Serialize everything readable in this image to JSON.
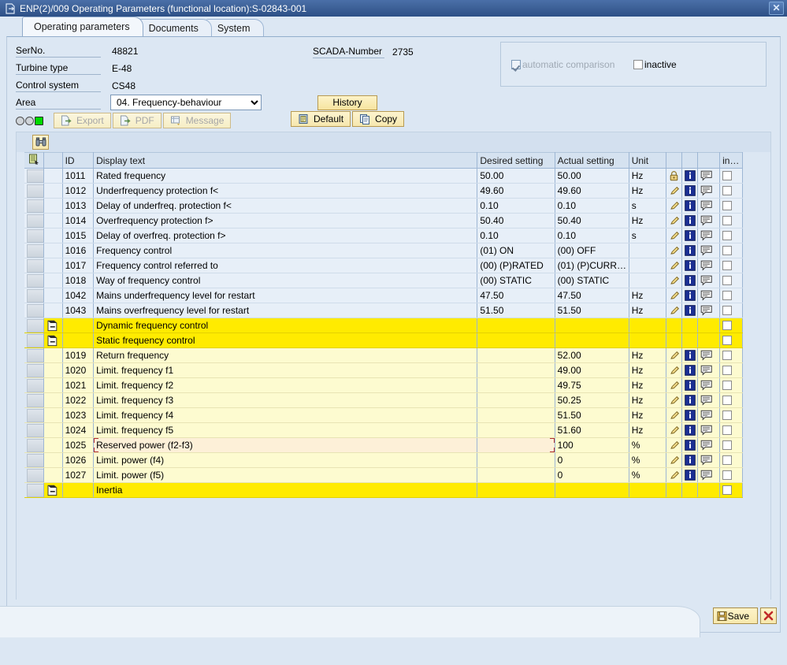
{
  "window": {
    "title": "ENP(2)/009 Operating Parameters (functional location):S-02843-001",
    "close_label": "✕",
    "icon": "window-document-icon"
  },
  "tabs": [
    {
      "label": "Operating parameters",
      "active": true
    },
    {
      "label": "Documents",
      "active": false
    },
    {
      "label": "System",
      "active": false
    }
  ],
  "form": {
    "serno_label": "SerNo.",
    "serno_value": "48821",
    "turbine_label": "Turbine type",
    "turbine_value": "E-48",
    "control_label": "Control system",
    "control_value": "CS48",
    "area_label": "Area",
    "area_value": "04. Frequency-behaviour",
    "area_options": [
      "04. Frequency-behaviour"
    ],
    "scada_label": "SCADA-Number",
    "scada_value": "2735"
  },
  "groupbox": {
    "automatic_comparison_label": "automatic comparison",
    "automatic_comparison_checked": true,
    "inactive_label": "inactive",
    "inactive_checked": false
  },
  "toolbar": {
    "export_label": "Export",
    "pdf_label": "PDF",
    "message_label": "Message",
    "history_label": "History",
    "default_label": "Default",
    "copy_label": "Copy",
    "find_icon": "binoculars-icon",
    "status_lights": [
      "gray-circle",
      "gray-circle",
      "green-square"
    ]
  },
  "grid": {
    "columns": [
      "",
      "",
      "ID",
      "Display text",
      "Desired setting",
      "Actual setting",
      "Unit",
      "",
      "",
      "",
      "in…"
    ],
    "rows": [
      {
        "kind": "normal",
        "id": "1011",
        "text": "Rated frequency",
        "desired": "50.00",
        "actual": "50.00",
        "unit": "Hz",
        "lock": true,
        "info": true,
        "note": true,
        "chk": true
      },
      {
        "kind": "normal",
        "id": "1012",
        "text": "Underfrequency protection f<",
        "desired": "49.60",
        "actual": "49.60",
        "unit": "Hz",
        "lock": false,
        "info": true,
        "note": true,
        "chk": true
      },
      {
        "kind": "normal",
        "id": "1013",
        "text": "Delay of underfreq. protection f<",
        "desired": "0.10",
        "actual": "0.10",
        "unit": "s",
        "lock": false,
        "info": true,
        "note": true,
        "chk": true
      },
      {
        "kind": "normal",
        "id": "1014",
        "text": "Overfrequency protection f>",
        "desired": "50.40",
        "actual": "50.40",
        "unit": "Hz",
        "lock": false,
        "info": true,
        "note": true,
        "chk": true
      },
      {
        "kind": "normal",
        "id": "1015",
        "text": "Delay of overfreq. protection f>",
        "desired": "0.10",
        "actual": "0.10",
        "unit": "s",
        "lock": false,
        "info": true,
        "note": true,
        "chk": true
      },
      {
        "kind": "normal",
        "id": "1016",
        "text": "Frequency control",
        "desired": "(01) ON",
        "actual": "(00) OFF",
        "unit": "",
        "lock": false,
        "info": true,
        "note": true,
        "chk": true
      },
      {
        "kind": "normal",
        "id": "1017",
        "text": "Frequency control referred to",
        "desired": "(00) (P)RATED",
        "actual": "(01) (P)CURR…",
        "unit": "",
        "lock": false,
        "info": true,
        "note": true,
        "chk": true
      },
      {
        "kind": "normal",
        "id": "1018",
        "text": "Way of frequency control",
        "desired": "(00) STATIC",
        "actual": "(00) STATIC",
        "unit": "",
        "lock": false,
        "info": true,
        "note": true,
        "chk": true
      },
      {
        "kind": "normal",
        "id": "1042",
        "text": "Mains underfrequency level for restart",
        "desired": "47.50",
        "actual": "47.50",
        "unit": "Hz",
        "lock": false,
        "info": true,
        "note": true,
        "chk": true
      },
      {
        "kind": "normal",
        "id": "1043",
        "text": "Mains overfrequency level for restart",
        "desired": "51.50",
        "actual": "51.50",
        "unit": "Hz",
        "lock": false,
        "info": true,
        "note": true,
        "chk": true
      },
      {
        "kind": "group",
        "id": "",
        "text": "Dynamic frequency control",
        "desired": "",
        "actual": "",
        "unit": "",
        "expand": true,
        "lock": false,
        "info": false,
        "note": false,
        "chk": true
      },
      {
        "kind": "group",
        "id": "",
        "text": "Static frequency control",
        "desired": "",
        "actual": "",
        "unit": "",
        "expand": true,
        "lock": false,
        "info": false,
        "note": false,
        "chk": true
      },
      {
        "kind": "child",
        "id": "1019",
        "text": "Return frequency",
        "desired": "",
        "actual": "52.00",
        "unit": "Hz",
        "lock": false,
        "info": true,
        "note": true,
        "chk": true
      },
      {
        "kind": "child",
        "id": "1020",
        "text": "Limit. frequency f1",
        "desired": "",
        "actual": "49.00",
        "unit": "Hz",
        "lock": false,
        "info": true,
        "note": true,
        "chk": true
      },
      {
        "kind": "child",
        "id": "1021",
        "text": "Limit. frequency f2",
        "desired": "",
        "actual": "49.75",
        "unit": "Hz",
        "lock": false,
        "info": true,
        "note": true,
        "chk": true
      },
      {
        "kind": "child",
        "id": "1022",
        "text": "Limit. frequency f3",
        "desired": "",
        "actual": "50.25",
        "unit": "Hz",
        "lock": false,
        "info": true,
        "note": true,
        "chk": true
      },
      {
        "kind": "child",
        "id": "1023",
        "text": "Limit. frequency f4",
        "desired": "",
        "actual": "51.50",
        "unit": "Hz",
        "lock": false,
        "info": true,
        "note": true,
        "chk": true
      },
      {
        "kind": "child",
        "id": "1024",
        "text": "Limit. frequency f5",
        "desired": "",
        "actual": "51.60",
        "unit": "Hz",
        "lock": false,
        "info": true,
        "note": true,
        "chk": true
      },
      {
        "kind": "child",
        "id": "1025",
        "text": "Reserved power (f2-f3)",
        "desired": "",
        "actual": "100",
        "unit": "%",
        "lock": false,
        "info": true,
        "note": true,
        "chk": true,
        "selected": true
      },
      {
        "kind": "child",
        "id": "1026",
        "text": "Limit. power (f4)",
        "desired": "",
        "actual": "0",
        "unit": "%",
        "lock": false,
        "info": true,
        "note": true,
        "chk": true
      },
      {
        "kind": "child",
        "id": "1027",
        "text": "Limit. power (f5)",
        "desired": "",
        "actual": "0",
        "unit": "%",
        "lock": false,
        "info": true,
        "note": true,
        "chk": true
      },
      {
        "kind": "group",
        "id": "",
        "text": "Inertia",
        "desired": "",
        "actual": "",
        "unit": "",
        "expand": true,
        "lock": false,
        "info": false,
        "note": false,
        "chk": true
      }
    ]
  },
  "footer": {
    "save_label": "Save",
    "cancel_icon": "red-x-icon"
  },
  "colors": {
    "title_bar": "#36598f",
    "accent_yellow": "#ffeb00",
    "child_yellow": "#fdfbd0",
    "row_blue": "#e7eff8",
    "panel_bg": "#dce7f3",
    "green_light": "#00d900",
    "info_blue": "#1b2f93"
  }
}
